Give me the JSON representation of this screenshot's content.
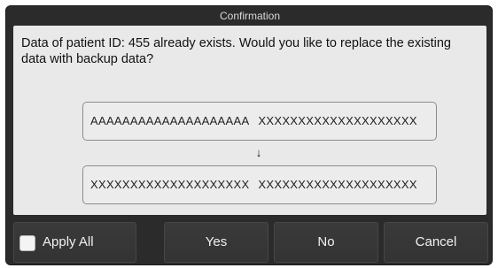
{
  "dialog": {
    "title": "Confirmation",
    "message": "Data of patient ID: 455 already exists. Would you like to replace the existing data with backup data?",
    "existing_data": {
      "left": "AAAAAAAAAAAAAAAAAAAA",
      "right": "XXXXXXXXXXXXXXXXXXXX"
    },
    "arrow_glyph": "↓",
    "backup_data": {
      "left": "XXXXXXXXXXXXXXXXXXXX",
      "right": "XXXXXXXXXXXXXXXXXXXX"
    }
  },
  "buttons": {
    "apply_all": {
      "label": "Apply All",
      "checked": false
    },
    "yes": "Yes",
    "no": "No",
    "cancel": "Cancel"
  },
  "colors": {
    "frame": "#2b2b2b",
    "content_bg": "#e9e9e9",
    "button_bg": "#363636",
    "button_text": "#f2f2f2"
  }
}
